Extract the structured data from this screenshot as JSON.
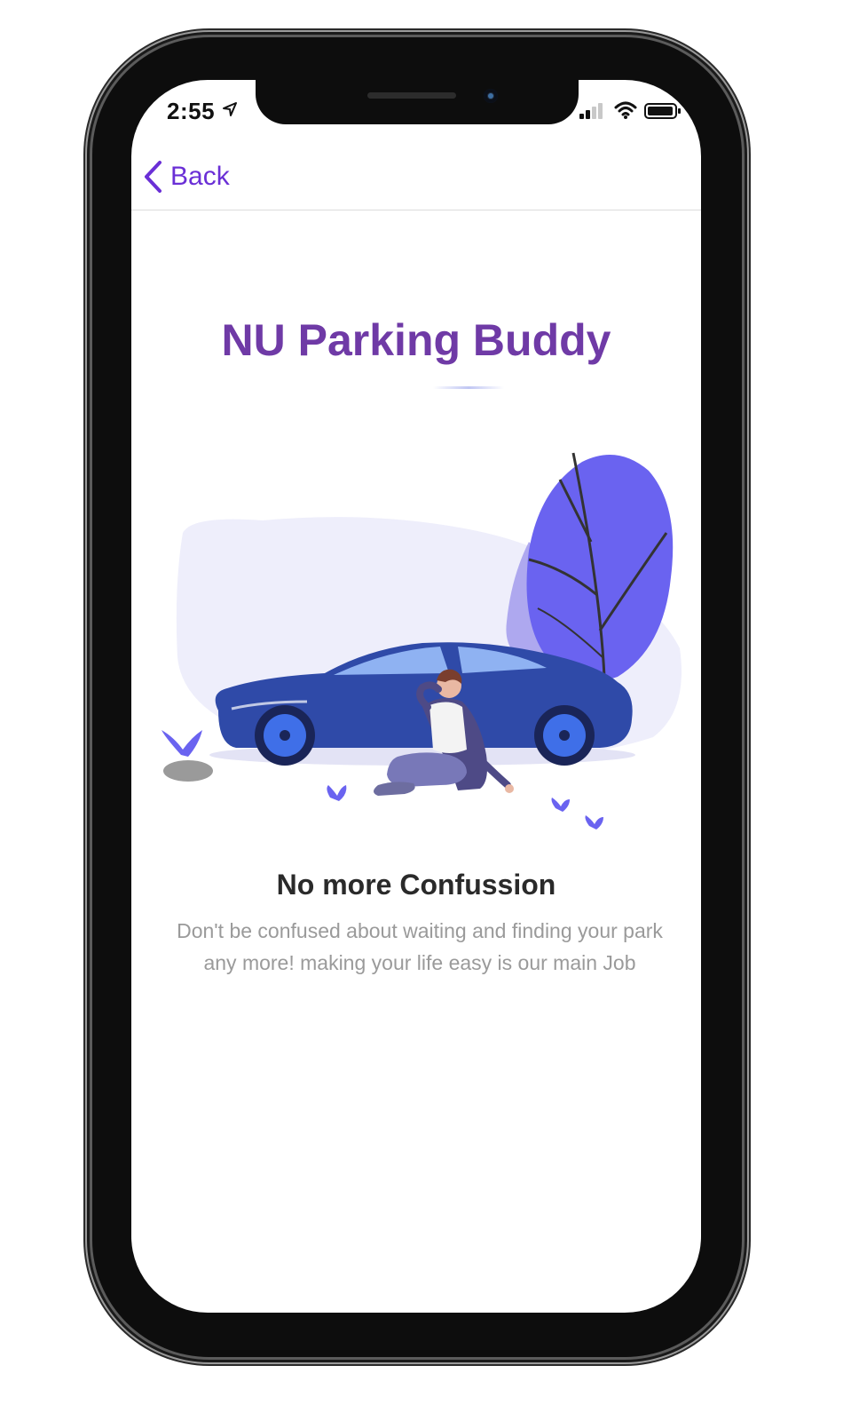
{
  "status_bar": {
    "time": "2:55"
  },
  "nav": {
    "back_label": "Back"
  },
  "main": {
    "app_title": "NU Parking Buddy",
    "headline": "No more Confussion",
    "description": "Don't be confused about waiting and finding your park any more!  making your life easy is our main Job"
  },
  "colors": {
    "accent": "#6a2fd6",
    "title": "#6f3aa6",
    "car_body": "#2f4aa8",
    "tree": "#6a63f0",
    "blob": "#eeeefb"
  },
  "icons": {
    "location": "location-arrow-icon",
    "signal": "cellular-signal-icon",
    "wifi": "wifi-icon",
    "battery": "battery-icon",
    "back": "chevron-left-icon"
  }
}
